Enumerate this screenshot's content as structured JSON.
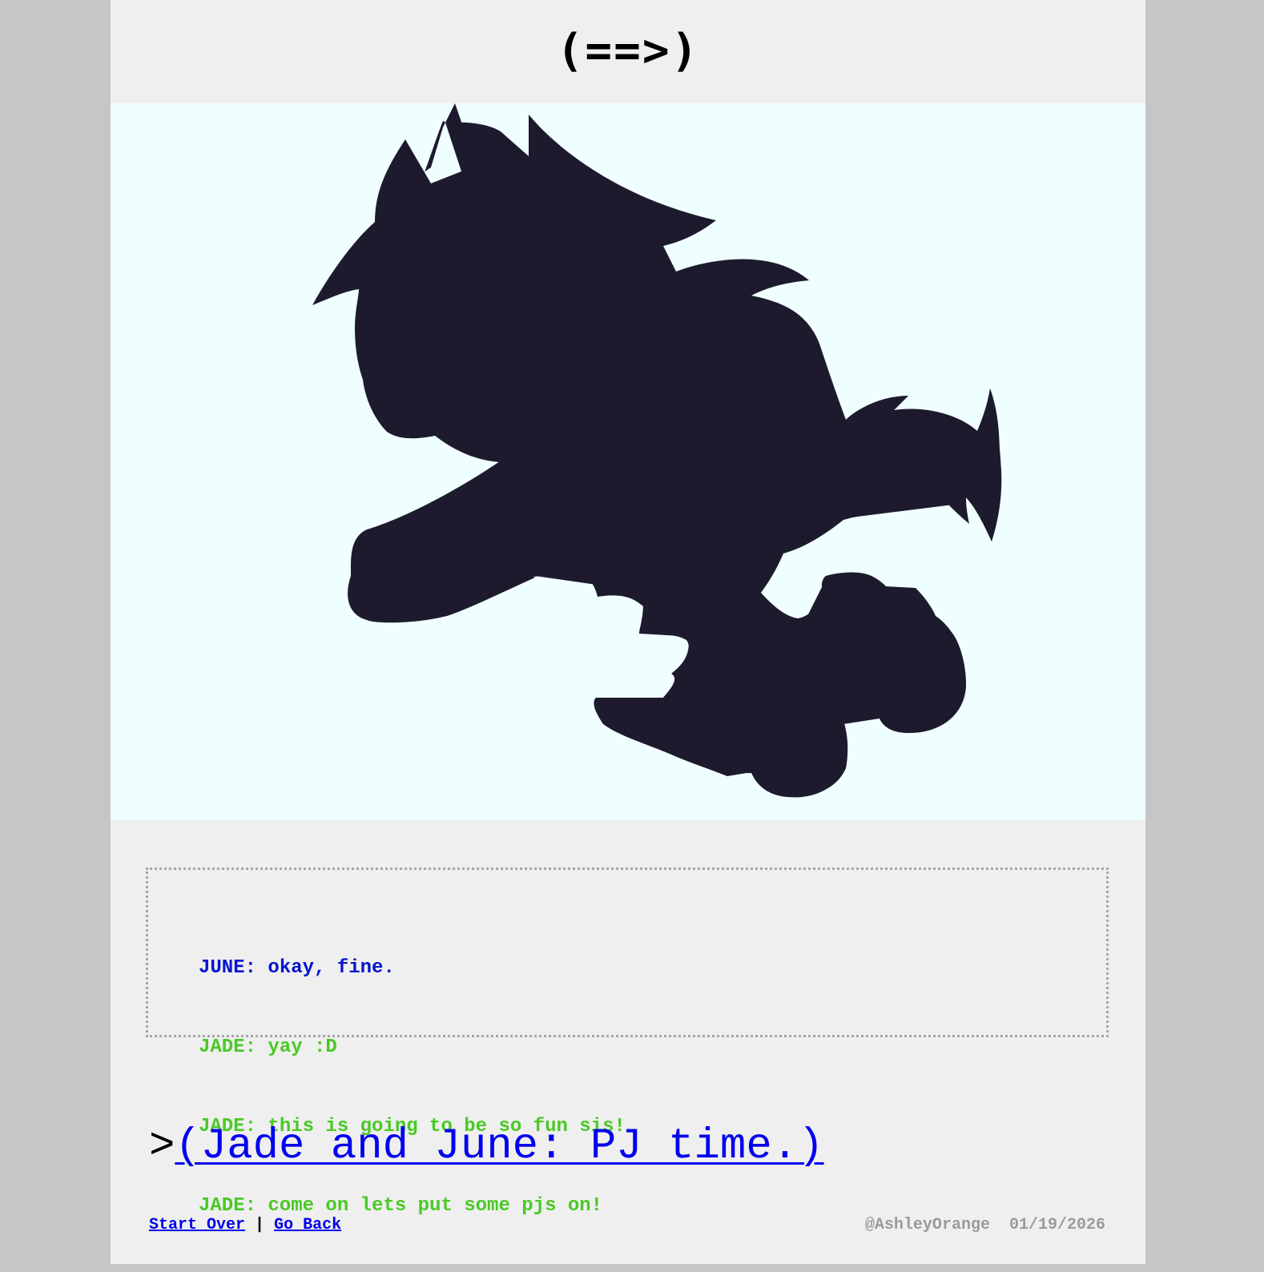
{
  "header": {
    "title": "(==>)"
  },
  "panel": {
    "image_description_icon": "silhouette-image",
    "background": "#efffff",
    "silhouette_color": "#1e1a2e"
  },
  "log": {
    "lines": [
      {
        "text": "JUNE: okay, fine.",
        "color": "#0715cd"
      },
      {
        "text": "JADE: yay :D",
        "color": "#4ac925"
      },
      {
        "text": "JADE: this is going to be so fun sis!",
        "color": "#4ac925"
      },
      {
        "text": "JADE: come on lets put some pjs on!",
        "color": "#4ac925"
      }
    ]
  },
  "command": {
    "prompt": ">",
    "link_text": "(Jade and June: PJ time.)"
  },
  "footer": {
    "start_over": "Start Over",
    "separator": "|",
    "go_back": "Go Back",
    "author": "@AshleyOrange",
    "date": "01/19/2026"
  }
}
